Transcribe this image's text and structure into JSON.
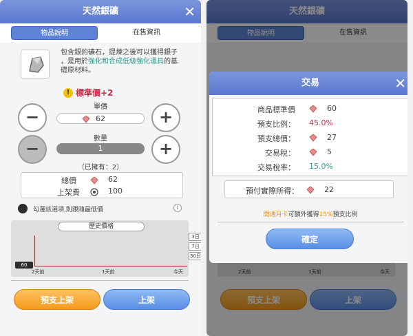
{
  "left": {
    "title": "天然銀礦",
    "close": "✕",
    "tabs": [
      "物品說明",
      "在售資訊"
    ],
    "desc": {
      "line1": "包含銀的礦石，提煉之後可以獲得銀子",
      "line2_pre": "，是用於",
      "line2_hl": "強化和合成低級強化道具",
      "line2_post": "的基",
      "line3": "礎原材料。"
    },
    "warn_icon": "!",
    "standard_price": "標準價+2",
    "unit_price_label": "單價",
    "unit_price": "62",
    "quantity_label": "數量",
    "quantity": "1",
    "minus": "−",
    "plus": "+",
    "owned": "（已擁有：2）",
    "total_label": "總價",
    "total": "62",
    "fee_label": "上架費",
    "fee": "100",
    "checkbox_text": "勾選該選項,則跟隨最低價",
    "info_icon": "i",
    "history_label": "歷史價格",
    "history_value": "60",
    "x_ticks": [
      "2天前",
      "1天前",
      "今天"
    ],
    "periods": [
      "3日",
      "7日",
      "30日"
    ],
    "btn_presale": "預支上架",
    "btn_list": "上架"
  },
  "right": {
    "title": "天然銀礦",
    "tabs": [
      "物品說明",
      "在售資訊"
    ],
    "dialog": {
      "title": "交易",
      "close": "✕",
      "rows": [
        {
          "k": "商品標準價",
          "v": "60",
          "gem": true,
          "style": ""
        },
        {
          "k": "預支比例：",
          "v": "45.0%",
          "gem": false,
          "style": "red"
        },
        {
          "k": "預支總價：",
          "v": "27",
          "gem": true,
          "style": ""
        },
        {
          "k": "交易稅：",
          "v": "5",
          "gem": true,
          "style": ""
        },
        {
          "k": "交易稅率：",
          "v": "15.0%",
          "gem": false,
          "style": "teal"
        }
      ],
      "actual_label": "預付實際所得：",
      "actual": "22",
      "promo_pre": "開通月卡",
      "promo_mid": "可額外獲得",
      "promo_pct": "15%",
      "promo_post": "預支比例",
      "confirm": "確定"
    },
    "x_ticks": [
      "2天前",
      "1天前",
      "今天"
    ],
    "btn_presale": "預支上架",
    "btn_list": "上架"
  },
  "colors": {
    "header": "#6a86d6",
    "red": "#c4324a",
    "teal": "#2f9a8c",
    "orange": "#f39a1c",
    "blue": "#5a8ee6"
  }
}
